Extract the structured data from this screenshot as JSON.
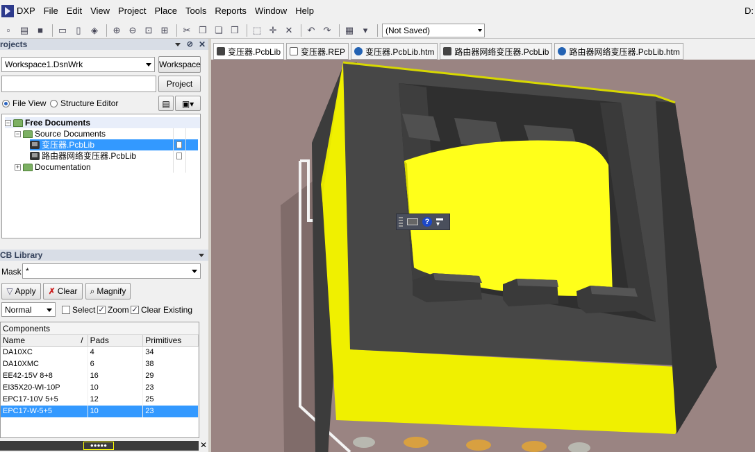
{
  "menubar": {
    "items": [
      "DXP",
      "File",
      "Edit",
      "View",
      "Project",
      "Place",
      "Tools",
      "Reports",
      "Window",
      "Help"
    ],
    "right_text": "D:"
  },
  "toolbar": {
    "status_select": "(Not Saved)"
  },
  "projects_panel": {
    "title": "rojects",
    "workspace_value": "Workspace1.DsnWrk",
    "workspace_button": "Workspace",
    "project_input": "",
    "project_button": "Project",
    "radio_file_view": "File View",
    "radio_structure_editor": "Structure Editor",
    "tree": {
      "root": "Free Documents",
      "source_folder": "Source Documents",
      "files": [
        "变压器.PcbLib",
        "路由器网络变压器.PcbLib"
      ],
      "documentation": "Documentation"
    }
  },
  "pcb_library": {
    "title": "CB Library",
    "mask_label": "Mask",
    "mask_value": "*",
    "apply": "Apply",
    "clear": "Clear",
    "magnify": "Magnify",
    "mode_value": "Normal",
    "select_label": "Select",
    "zoom_label": "Zoom",
    "clear_existing_label": "Clear Existing",
    "components_header": "Components",
    "columns": [
      "Name",
      "Pads",
      "Primitives"
    ],
    "sort_marker": "/",
    "rows": [
      {
        "name": "DA10XC",
        "pads": "4",
        "primitives": "34"
      },
      {
        "name": "DA10XMC",
        "pads": "6",
        "primitives": "38"
      },
      {
        "name": "EE42-15V 8+8",
        "pads": "16",
        "primitives": "29"
      },
      {
        "name": "EI35X20-WI-10P",
        "pads": "10",
        "primitives": "23"
      },
      {
        "name": "EPC17-10V 5+5",
        "pads": "12",
        "primitives": "25"
      },
      {
        "name": "EPC17-W-5+5",
        "pads": "10",
        "primitives": "23"
      }
    ],
    "selected_row": 5
  },
  "doc_tabs": [
    {
      "label": "变压器.PcbLib",
      "icon": "pcblib-icon",
      "active": true
    },
    {
      "label": "变压器.REP",
      "icon": "report-icon",
      "active": false
    },
    {
      "label": "变压器.PcbLib.htm",
      "icon": "htm-icon",
      "active": false
    },
    {
      "label": "路由器网络变压器.PcbLib",
      "icon": "pcblib-icon",
      "active": false
    },
    {
      "label": "路由器网络变压器.PcbLib.htm",
      "icon": "htm-icon",
      "active": false
    }
  ],
  "mini_toolbar": {
    "help_glyph": "?"
  },
  "colors": {
    "view_bg": "#9a8482",
    "core_yellow": "#ffff00",
    "body_dark": "#404040",
    "selection_blue": "#3399ff"
  }
}
